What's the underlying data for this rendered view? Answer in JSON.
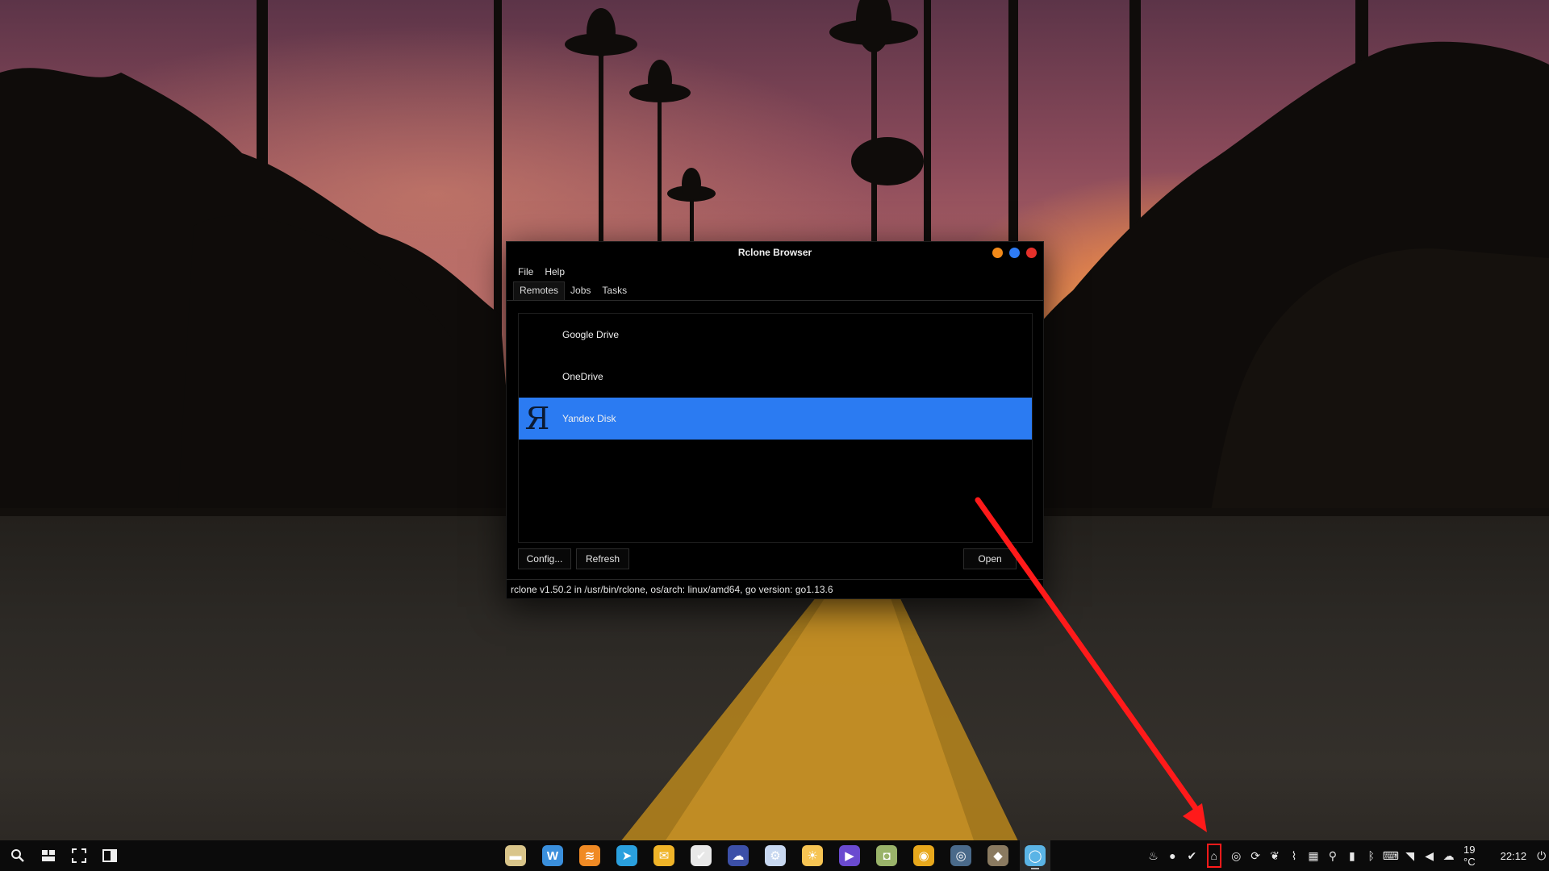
{
  "window": {
    "title": "Rclone Browser",
    "controls": [
      {
        "name": "minimize-button",
        "color": "#f28a19"
      },
      {
        "name": "maximize-button",
        "color": "#2e7cf6"
      },
      {
        "name": "close-button",
        "color": "#e6302a"
      }
    ],
    "menu": [
      "File",
      "Help"
    ],
    "tabs": [
      {
        "label": "Remotes",
        "active": true
      },
      {
        "label": "Jobs",
        "active": false
      },
      {
        "label": "Tasks",
        "active": false
      }
    ],
    "remotes": [
      {
        "label": "Google Drive",
        "icon": "google-drive-icon",
        "selected": false
      },
      {
        "label": "OneDrive",
        "icon": "onedrive-icon",
        "selected": false
      },
      {
        "label": "Yandex Disk",
        "icon": "yandex-disk-icon",
        "icon_glyph": "Я",
        "selected": true
      }
    ],
    "buttons": {
      "config": "Config...",
      "refresh": "Refresh",
      "open": "Open"
    },
    "status": "rclone v1.50.2 in /usr/bin/rclone, os/arch: linux/amd64, go version: go1.13.6"
  },
  "colors": {
    "selection": "#2b7bf2",
    "annotation": "#ff1a1a"
  },
  "taskbar": {
    "left_icons": [
      "search-icon",
      "workspaces-icon",
      "fullscreen-icon",
      "panel-icon"
    ],
    "apps": [
      {
        "name": "file-manager-icon",
        "color": "#d9c58a",
        "glyph": "▬"
      },
      {
        "name": "wingpanel-w-icon",
        "color": "#3a8fdc",
        "glyph": "W"
      },
      {
        "name": "rss-icon",
        "color": "#f08a24",
        "glyph": "≋"
      },
      {
        "name": "telegram-icon",
        "color": "#2aa0de",
        "glyph": "➤"
      },
      {
        "name": "mail-icon",
        "color": "#f0b428",
        "glyph": "✉"
      },
      {
        "name": "tasks-check-icon",
        "color": "#e8e8e8",
        "glyph": "✔"
      },
      {
        "name": "cloud-app-icon",
        "color": "#3c50a8",
        "glyph": "☁"
      },
      {
        "name": "settings-app-icon",
        "color": "#c8d8f0",
        "glyph": "⚙"
      },
      {
        "name": "weather-app-icon",
        "color": "#f6c453",
        "glyph": "☀"
      },
      {
        "name": "video-app-icon",
        "color": "#6a4ad0",
        "glyph": "▶"
      },
      {
        "name": "android-app-icon",
        "color": "#9ab36a",
        "glyph": "◘"
      },
      {
        "name": "chrome-icon",
        "color": "#e8a81c",
        "glyph": "◉"
      },
      {
        "name": "network-app-icon",
        "color": "#4a6a8a",
        "glyph": "◎"
      },
      {
        "name": "gimp-icon",
        "color": "#8a7a60",
        "glyph": "◆"
      },
      {
        "name": "rclone-browser-icon",
        "color": "#5ab4e6",
        "glyph": "◯",
        "active": true
      }
    ],
    "tray": [
      "tray-flame-icon",
      "tray-chat-icon",
      "tray-check-icon",
      "tray-rclone-lock-icon",
      "tray-steam-icon",
      "tray-sync-icon",
      "tray-leaf-icon",
      "tray-paperclip-icon",
      "tray-grid-icon",
      "tray-location-icon",
      "tray-battery-icon",
      "tray-bluetooth-icon",
      "tray-keyboard-icon",
      "tray-wifi-icon",
      "tray-volume-icon",
      "tray-weather-icon"
    ],
    "highlighted_tray": "tray-rclone-lock-icon",
    "weather": "19 °C",
    "clock": "22:12",
    "power": "power-icon"
  }
}
